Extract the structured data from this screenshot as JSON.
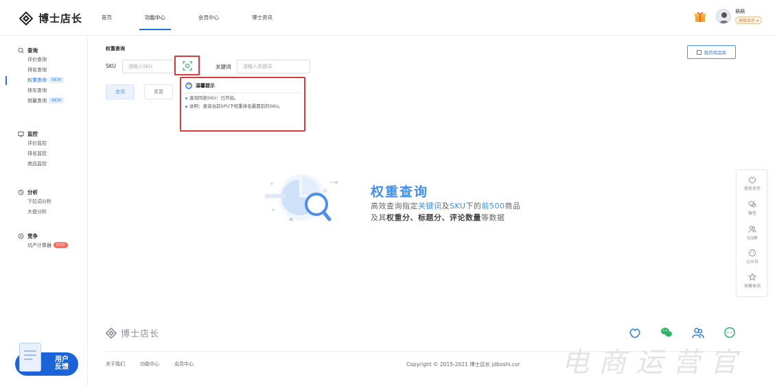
{
  "brand": {
    "name": "博士店长"
  },
  "nav": {
    "items": [
      {
        "label": "首页",
        "active": false
      },
      {
        "label": "功能中心",
        "active": true
      },
      {
        "label": "会员中心",
        "active": false
      },
      {
        "label": "博士资讯",
        "active": false
      }
    ]
  },
  "user": {
    "name": "萌萌",
    "badge": "高级会员 ▾"
  },
  "sidebar": {
    "groups": [
      {
        "title": "查询",
        "icon": "search-icon",
        "items": [
          {
            "label": "评价查询",
            "tag": ""
          },
          {
            "label": "排名查询",
            "tag": ""
          },
          {
            "label": "权重查询",
            "tag": "NEW",
            "active": true
          },
          {
            "label": "快车查询",
            "tag": ""
          },
          {
            "label": "销量查询",
            "tag": "NEW"
          }
        ]
      },
      {
        "title": "监控",
        "icon": "monitor-icon",
        "items": [
          {
            "label": "评价监控",
            "tag": ""
          },
          {
            "label": "排名监控",
            "tag": ""
          },
          {
            "label": "商品监控",
            "tag": ""
          }
        ]
      },
      {
        "title": "分析",
        "icon": "clock-icon",
        "items": [
          {
            "label": "下拉词分析",
            "tag": ""
          },
          {
            "label": "大盘分析",
            "tag": ""
          }
        ]
      },
      {
        "title": "竞争",
        "icon": "compete-icon",
        "items": [
          {
            "label": "坑产计算器",
            "tag": "HOT"
          }
        ]
      }
    ]
  },
  "feedback": {
    "line1": "用户",
    "line2": "反馈"
  },
  "main": {
    "section_title": "权重查询",
    "sku_label": "SKU",
    "sku_placeholder": "请输入SKU",
    "keyword_label": "关键词",
    "keyword_placeholder": "请输入关键词",
    "query_button": "查询",
    "reset_button": "重置",
    "my_library": "我的商品库"
  },
  "tip": {
    "title": "温馨提示",
    "line1": "查询同款SKU：已开启。",
    "line2": "说明：查询当前SPU下权重排名最靠前的SKU。"
  },
  "hero": {
    "title": "权重查询",
    "line1": [
      "高效查询指定",
      "关键词",
      "及",
      "SKU",
      "下的",
      "前500",
      "商品"
    ],
    "line2": [
      "及其",
      "权重分、标题分、评论数量",
      "等数据"
    ]
  },
  "float_bar": {
    "items": [
      "商务合作",
      "微信",
      "QQ群",
      "公众号",
      "收藏本站"
    ]
  },
  "footer": {
    "brand": "博士店长",
    "links": [
      "关于我们",
      "功能中心",
      "会员中心"
    ],
    "copyright": "Copyright © 2015-2021 博士店长 jdboshi.cor",
    "watermark": "电商运营官"
  },
  "colors": {
    "accent": "#1f6fe5",
    "highlight": "#d93b3b",
    "hero_blue": "#3f8df5",
    "hot": "#ff6a5a"
  }
}
